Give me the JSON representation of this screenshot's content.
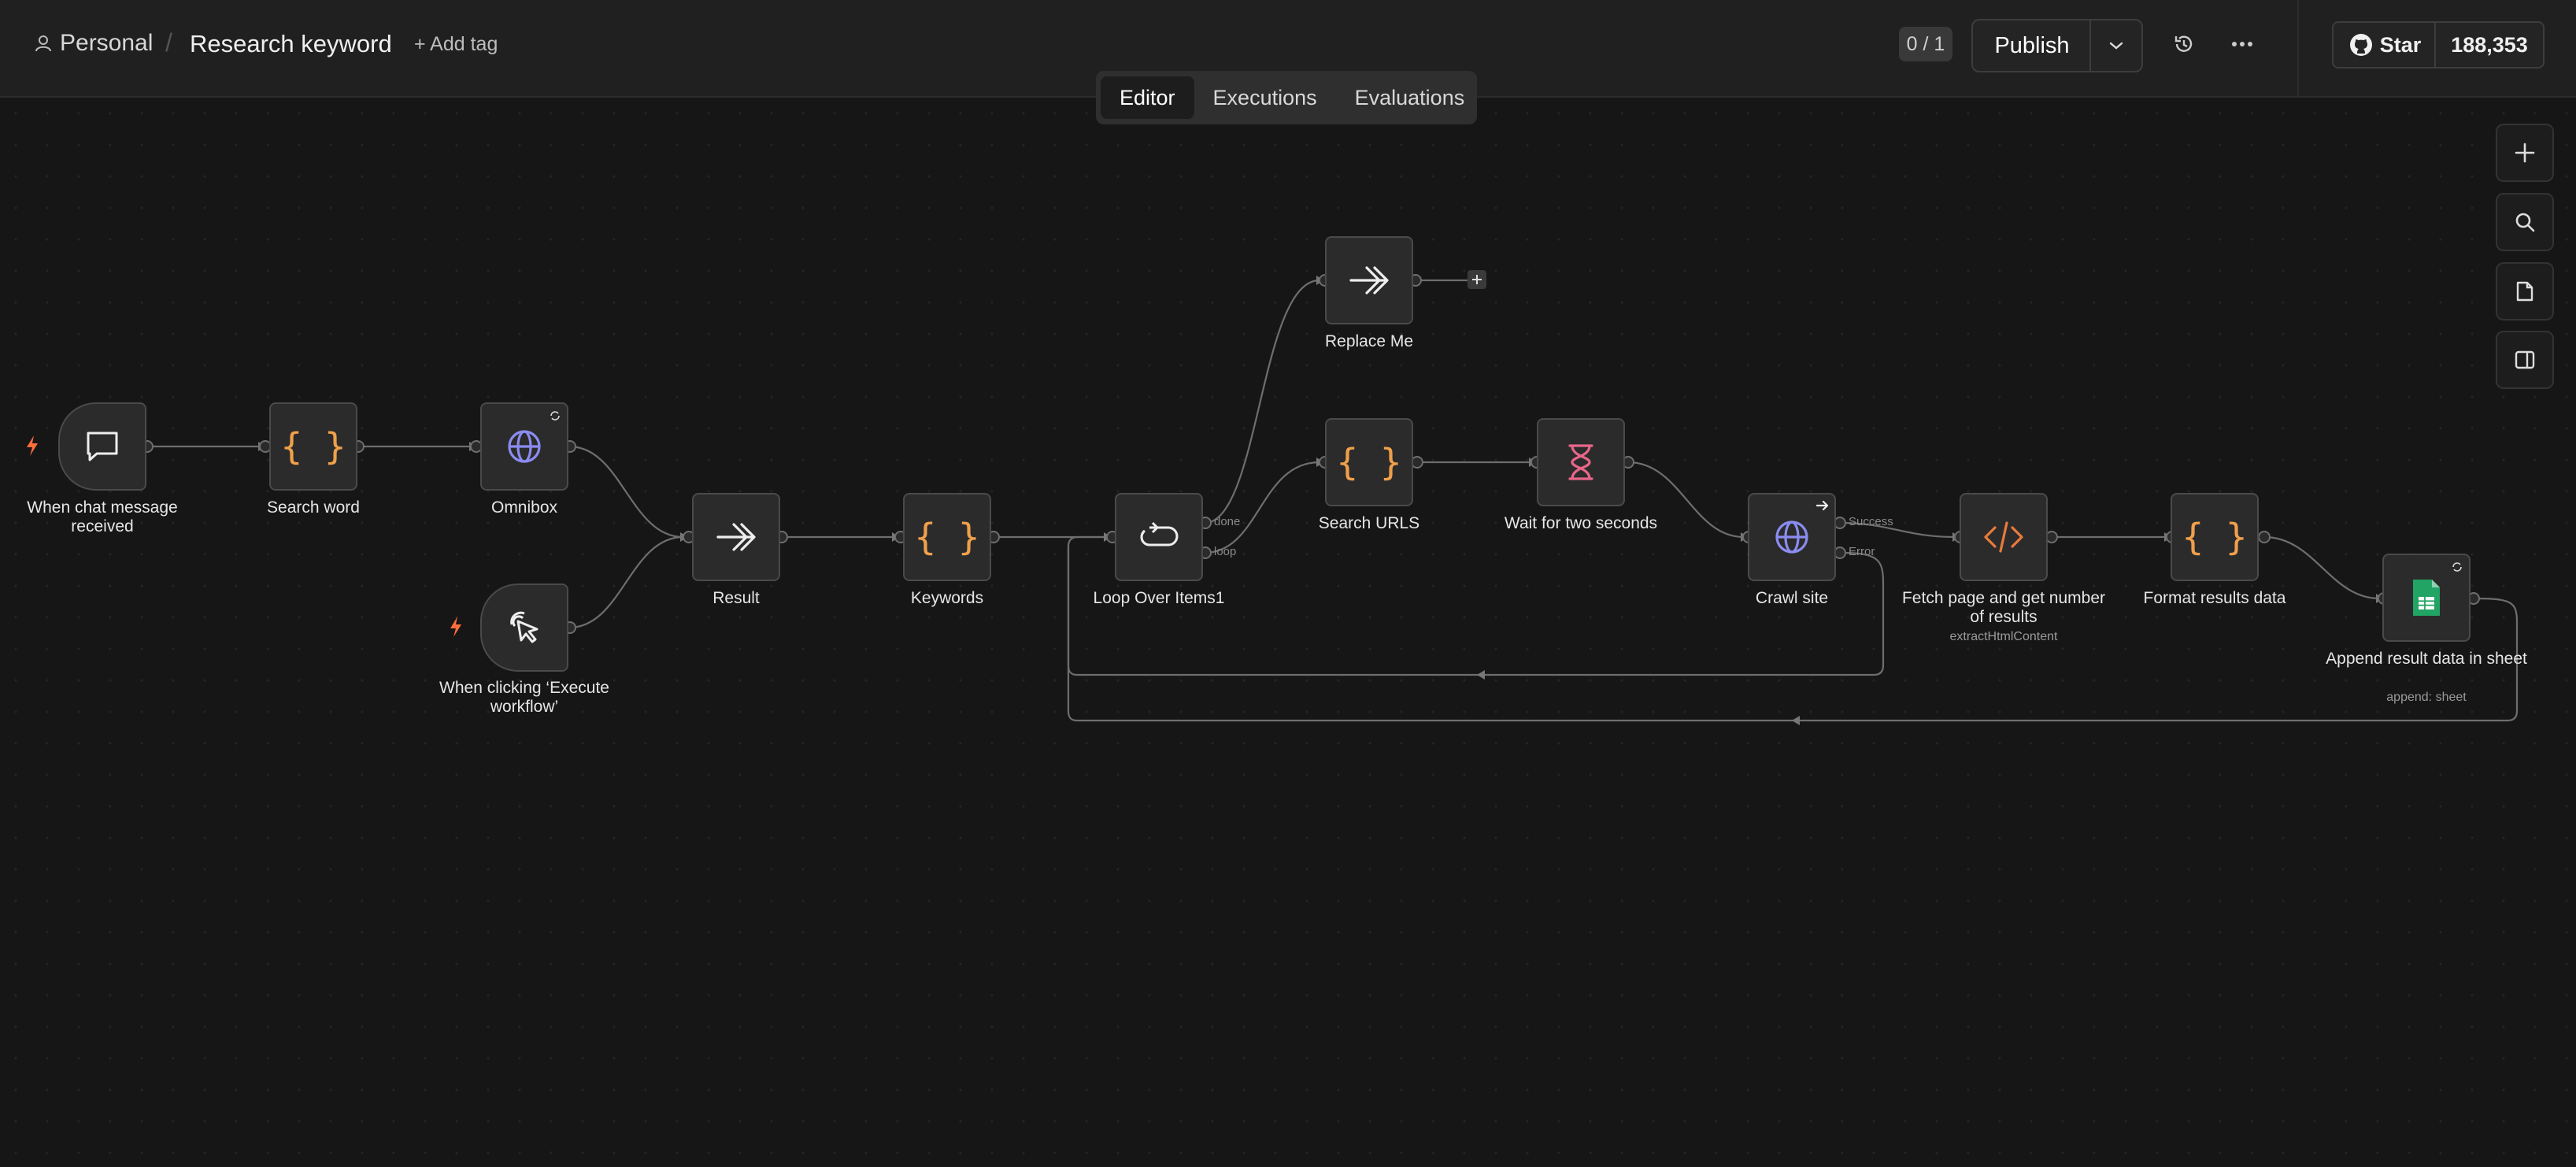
{
  "header": {
    "project": "Personal",
    "workflow_title": "Research keyword",
    "add_tag": "+ Add tag",
    "version_counter": "0 / 1",
    "publish_label": "Publish",
    "github_star_label": "Star",
    "github_star_count": "188,353"
  },
  "tabs": [
    {
      "label": "Editor",
      "active": true
    },
    {
      "label": "Executions",
      "active": false
    },
    {
      "label": "Evaluations",
      "active": false
    }
  ],
  "nodes": {
    "chat_trigger": {
      "label": "When chat message received",
      "icon": "chat-bubble-icon"
    },
    "search_word": {
      "label": "Search word",
      "icon": "braces-icon"
    },
    "omnibox": {
      "label": "Omnibox",
      "icon": "globe-icon"
    },
    "manual_trigger": {
      "label": "When clicking ‘Execute workflow’",
      "icon": "cursor-click-icon"
    },
    "result": {
      "label": "Result",
      "icon": "double-arrow-icon"
    },
    "keywords": {
      "label": "Keywords",
      "icon": "braces-icon"
    },
    "loop": {
      "label": "Loop Over Items1",
      "icon": "loop-icon",
      "outputs": [
        "done",
        "loop"
      ]
    },
    "replace_me": {
      "label": "Replace Me",
      "icon": "double-arrow-icon"
    },
    "search_urls": {
      "label": "Search URLS",
      "icon": "braces-icon"
    },
    "wait": {
      "label": "Wait for two seconds",
      "icon": "hourglass-icon"
    },
    "crawl": {
      "label": "Crawl site",
      "icon": "globe-icon",
      "outputs": [
        "Success",
        "Error"
      ]
    },
    "fetch": {
      "label": "Fetch page and get number of results",
      "sublabel": "extractHtmlContent",
      "icon": "code-icon"
    },
    "format": {
      "label": "Format results data",
      "icon": "braces-icon"
    },
    "append": {
      "label": "Append result data in sheet",
      "sublabel": "append: sheet",
      "icon": "google-sheets-icon"
    }
  },
  "colors": {
    "braces": "#f0a04b",
    "globe": "#8b8cf0",
    "hourglass": "#e8668a",
    "code": "#e87a3c",
    "sheets": "#21a464",
    "trigger_bolt": "#ff6d3b"
  }
}
